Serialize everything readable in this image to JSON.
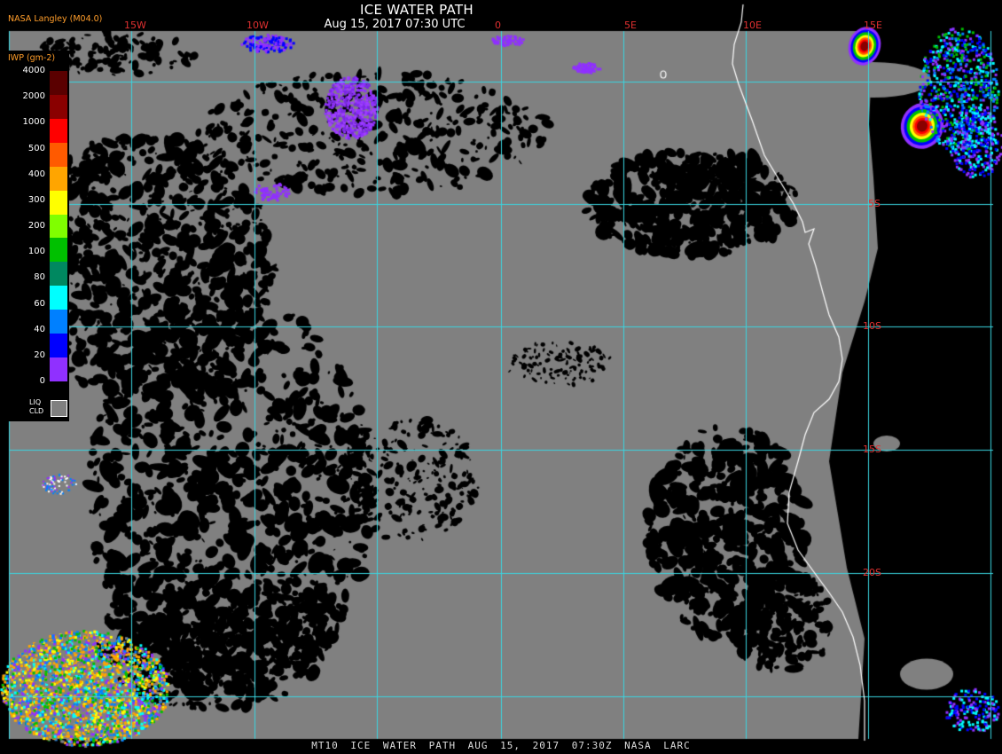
{
  "title": "ICE WATER PATH",
  "date_line": "Aug 15, 2017 07:30 UTC",
  "producer": "NASA Langley (M04.0)",
  "footer": "MT10  ICE WATER PATH  AUG 15, 2017 07:30Z  NASA LARC",
  "longitude_labels": [
    "15W",
    "10W",
    "0",
    "5E",
    "10E",
    "15E"
  ],
  "latitude_labels": [
    "5S",
    "10S",
    "15S",
    "20S"
  ],
  "legend": {
    "title": "IWP (gm-2)",
    "ticks": [
      "4000",
      "2000",
      "1000",
      "500",
      "400",
      "300",
      "200",
      "100",
      "80",
      "60",
      "40",
      "20",
      "0"
    ],
    "colors": [
      "#5a0000",
      "#8a0000",
      "#ff0000",
      "#ff5a00",
      "#ffa500",
      "#ffff00",
      "#80ff00",
      "#00c000",
      "#008860",
      "#00ffff",
      "#0080ff",
      "#0000ff",
      "#9030ff"
    ],
    "liq_label_1": "LIQ",
    "liq_label_2": "CLD",
    "liq_color": "#808080"
  },
  "colors": {
    "liquid_cloud": "#808080",
    "clear": "#000000",
    "grid": "#3ad6e0",
    "coastline": "#ffffff",
    "label_red": "#e03030",
    "label_orange": "#ff9d2a"
  }
}
